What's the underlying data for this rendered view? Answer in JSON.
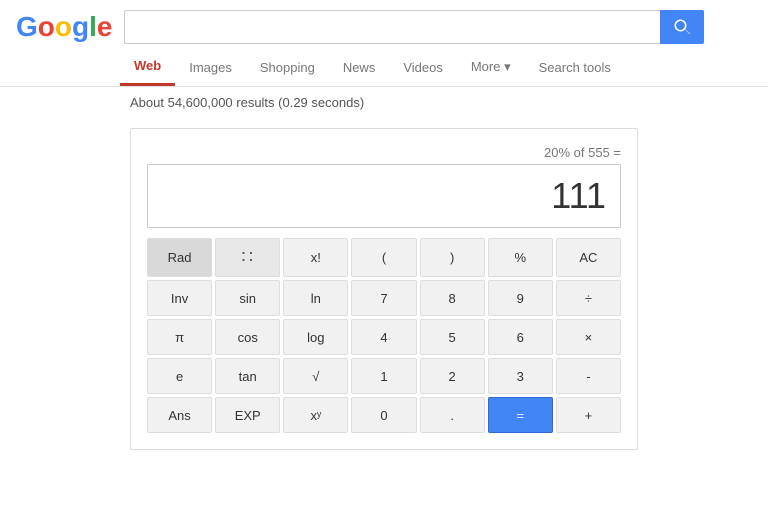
{
  "logo": {
    "letters": [
      {
        "char": "G",
        "class": "logo-b"
      },
      {
        "char": "o",
        "class": "logo-l"
      },
      {
        "char": "o",
        "class": "logo-u"
      },
      {
        "char": "g",
        "class": "logo-e"
      },
      {
        "char": "l",
        "class": "logo-r"
      },
      {
        "char": "e",
        "class": "logo-i"
      }
    ]
  },
  "search": {
    "query": "20% of 555",
    "placeholder": ""
  },
  "nav": {
    "items": [
      {
        "label": "Web",
        "active": true
      },
      {
        "label": "Images",
        "active": false
      },
      {
        "label": "Shopping",
        "active": false
      },
      {
        "label": "News",
        "active": false
      },
      {
        "label": "Videos",
        "active": false
      },
      {
        "label": "More",
        "active": false,
        "has_arrow": true
      },
      {
        "label": "Search tools",
        "active": false
      }
    ]
  },
  "results": {
    "info": "About 54,600,000 results (0.29 seconds)"
  },
  "calculator": {
    "expression": "20% of 555 =",
    "result": "111",
    "buttons": [
      {
        "label": "Rad",
        "type": "dark"
      },
      {
        "label": "⠿",
        "type": "grid-icon"
      },
      {
        "label": "x!",
        "type": "normal"
      },
      {
        "label": "(",
        "type": "normal"
      },
      {
        "label": ")",
        "type": "normal"
      },
      {
        "label": "%",
        "type": "normal"
      },
      {
        "label": "AC",
        "type": "normal"
      },
      {
        "label": "Inv",
        "type": "normal"
      },
      {
        "label": "sin",
        "type": "normal"
      },
      {
        "label": "ln",
        "type": "normal"
      },
      {
        "label": "7",
        "type": "normal"
      },
      {
        "label": "8",
        "type": "normal"
      },
      {
        "label": "9",
        "type": "normal"
      },
      {
        "label": "÷",
        "type": "normal"
      },
      {
        "label": "π",
        "type": "normal"
      },
      {
        "label": "cos",
        "type": "normal"
      },
      {
        "label": "log",
        "type": "normal"
      },
      {
        "label": "4",
        "type": "normal"
      },
      {
        "label": "5",
        "type": "normal"
      },
      {
        "label": "6",
        "type": "normal"
      },
      {
        "label": "×",
        "type": "normal"
      },
      {
        "label": "e",
        "type": "normal"
      },
      {
        "label": "tan",
        "type": "normal"
      },
      {
        "label": "√",
        "type": "normal"
      },
      {
        "label": "1",
        "type": "normal"
      },
      {
        "label": "2",
        "type": "normal"
      },
      {
        "label": "3",
        "type": "normal"
      },
      {
        "label": "-",
        "type": "normal"
      },
      {
        "label": "Ans",
        "type": "normal"
      },
      {
        "label": "EXP",
        "type": "normal"
      },
      {
        "label": "xʸ",
        "type": "normal"
      },
      {
        "label": "0",
        "type": "normal"
      },
      {
        "label": ".",
        "type": "normal"
      },
      {
        "label": "=",
        "type": "blue"
      },
      {
        "label": "+",
        "type": "normal"
      }
    ]
  }
}
